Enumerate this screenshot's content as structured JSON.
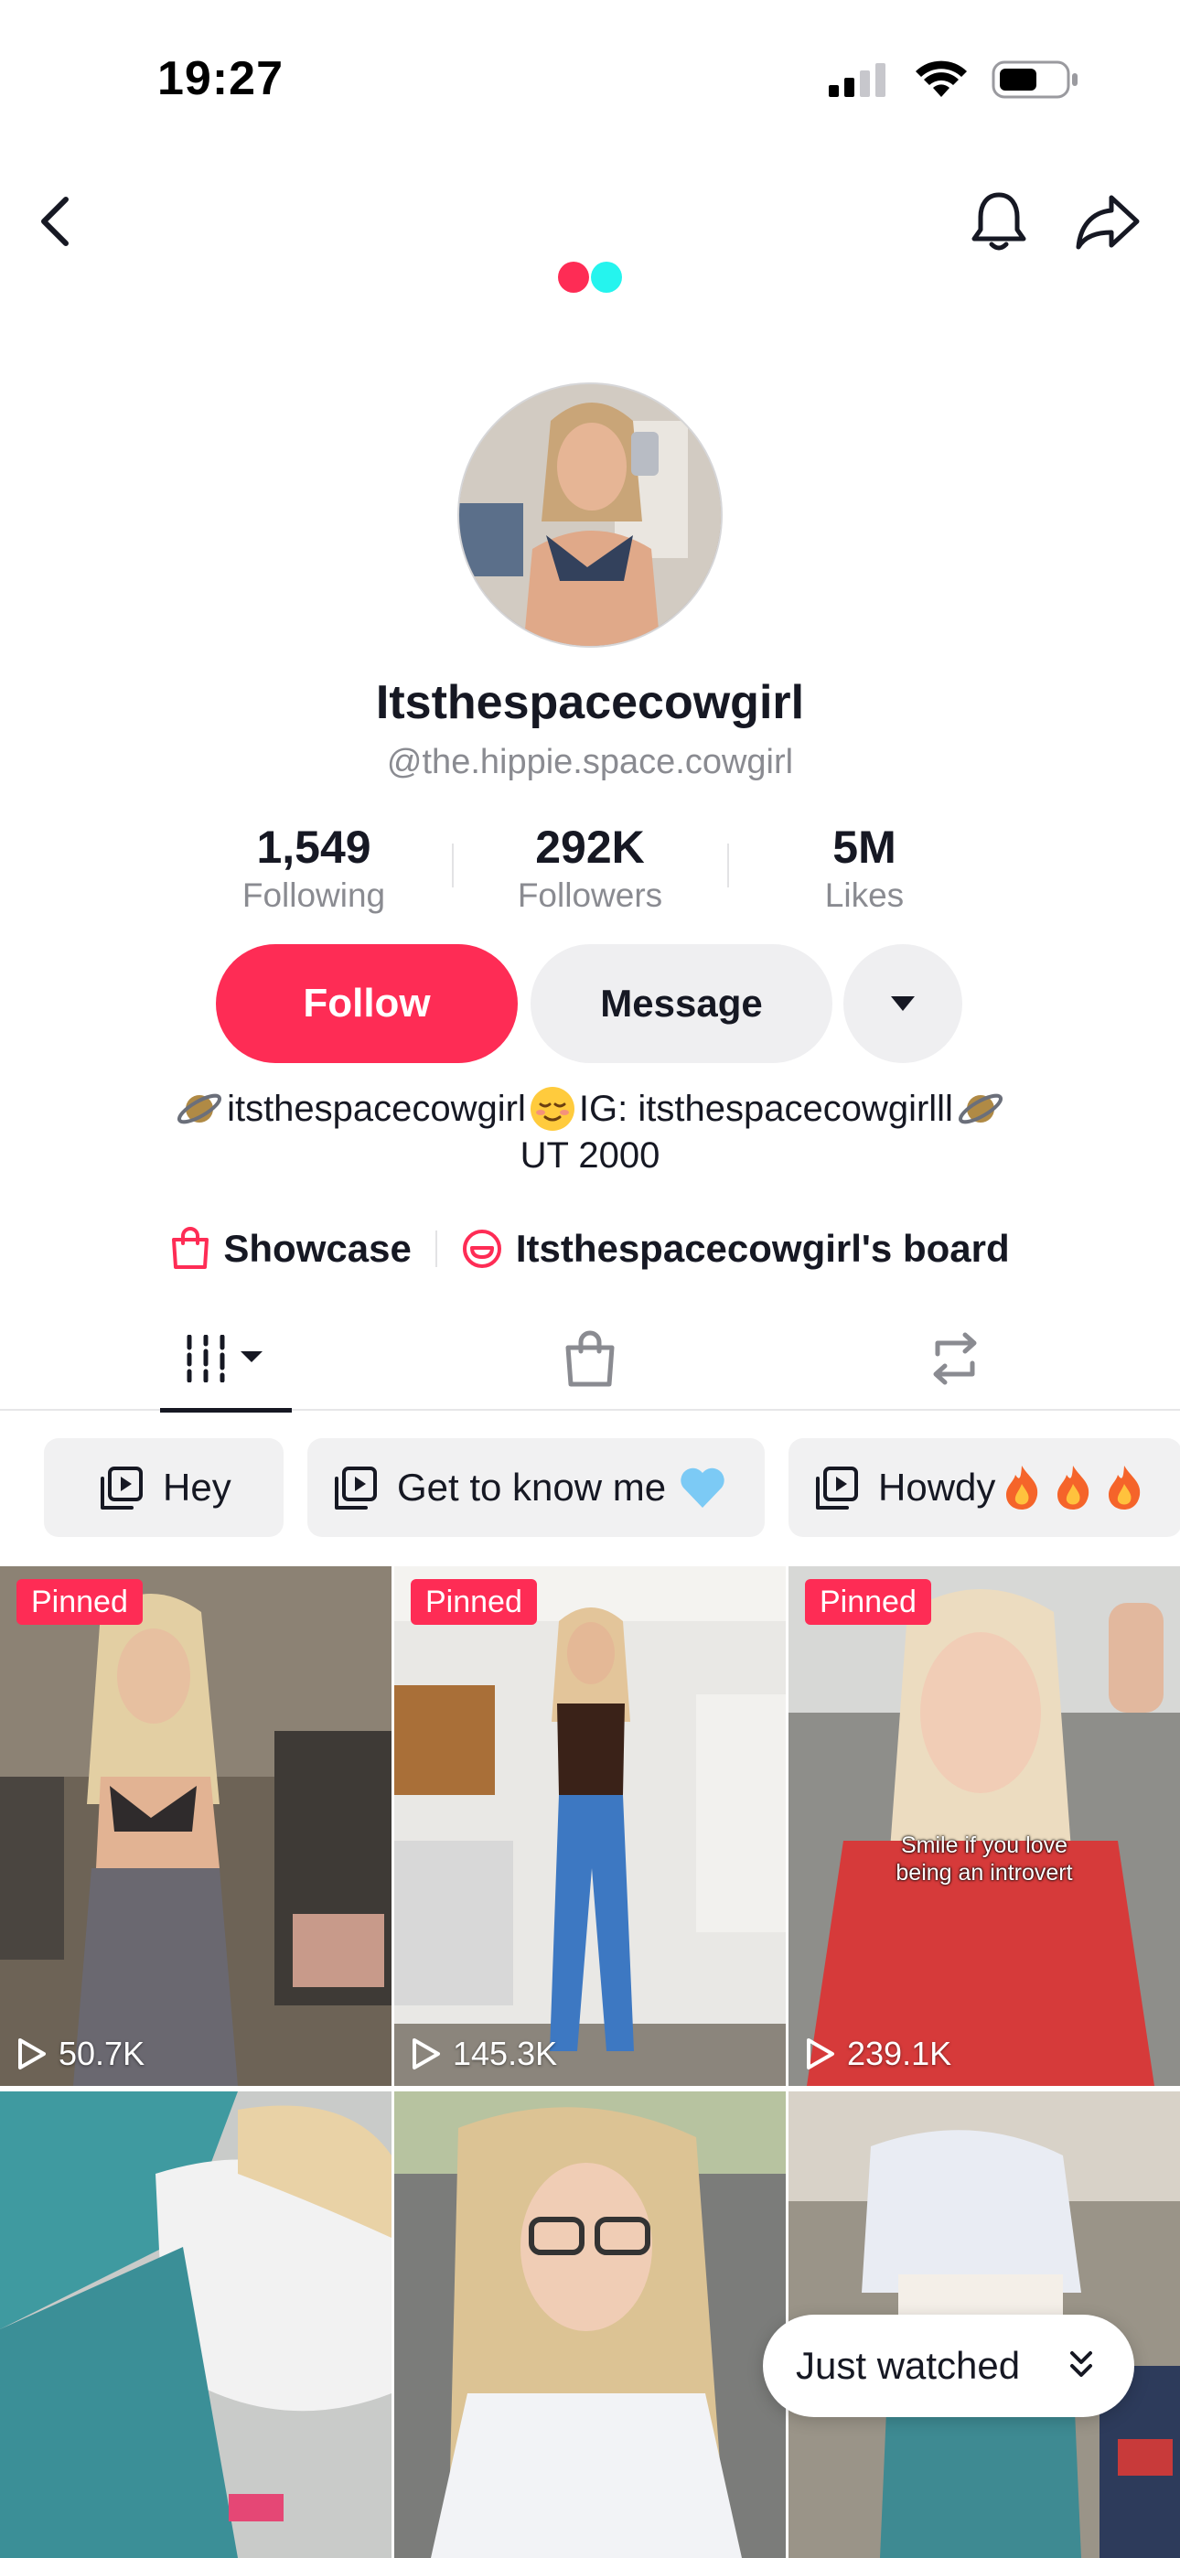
{
  "status_bar": {
    "time": "19:27",
    "battery_level": 0.55
  },
  "nav": {
    "back_icon": "chevron-left-icon",
    "bell_icon": "bell-icon",
    "share_icon": "share-arrow-icon"
  },
  "brand_colors": {
    "red": "#fe2c55",
    "cyan": "#25f4ee"
  },
  "profile": {
    "display_name": "Itsthespacecowgirl",
    "username": "@the.hippie.space.cowgirl"
  },
  "stats": [
    {
      "value": "1,549",
      "label": "Following"
    },
    {
      "value": "292K",
      "label": "Followers"
    },
    {
      "value": "5M",
      "label": "Likes"
    }
  ],
  "actions": {
    "follow_label": "Follow",
    "message_label": "Message"
  },
  "bio": {
    "line1_part1": "itsthespacecowgirl",
    "line1_part2": " IG: itsthespacecowgirlll ",
    "line2": "UT 2000"
  },
  "links": {
    "showcase": "Showcase",
    "board": "Itsthespacecowgirl's board"
  },
  "collections": [
    {
      "label": "Hey"
    },
    {
      "label": "Get to know me"
    },
    {
      "label": "Howdy"
    }
  ],
  "videos": [
    {
      "pinned": "Pinned",
      "views": "50.7K",
      "caption": ""
    },
    {
      "pinned": "Pinned",
      "views": "145.3K",
      "caption": ""
    },
    {
      "pinned": "Pinned",
      "views": "239.1K",
      "caption_line1": "Smile if you love",
      "caption_line2": "being an introvert"
    },
    {
      "pinned": "",
      "views": "",
      "caption": ""
    },
    {
      "pinned": "",
      "views": "",
      "caption": ""
    },
    {
      "pinned": "",
      "views": "",
      "caption": ""
    }
  ],
  "just_watched": {
    "label": "Just watched"
  }
}
